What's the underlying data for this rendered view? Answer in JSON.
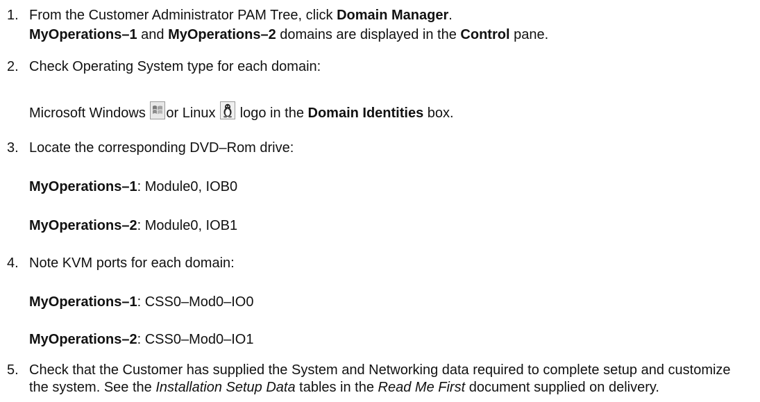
{
  "steps": [
    {
      "number": "1.",
      "line1": {
        "pre": "From the Customer Administrator PAM Tree, click ",
        "bold": "Domain Manager",
        "post": "."
      },
      "line2": {
        "bold1": "MyOperations–1",
        "mid1": " and ",
        "bold2": "MyOperations–2",
        "mid2": " domains are displayed in the ",
        "bold3": "Control",
        "post": " pane."
      }
    },
    {
      "number": "2.",
      "line1": "Check Operating System type for each domain:",
      "line2": {
        "pre": "Microsoft Windows ",
        "windows_icon": "windows-logo-icon",
        "mid": "or Linux ",
        "linux_icon": "linux-tux-logo-icon",
        "mid2": " logo in the ",
        "bold": "Domain Identities",
        "post": " box."
      }
    },
    {
      "number": "3.",
      "line1": "Locate the corresponding DVD–Rom drive:",
      "entries": [
        {
          "name": "MyOperations–1",
          "value": ": Module0, IOB0"
        },
        {
          "name": "MyOperations–2",
          "value": ": Module0, IOB1"
        }
      ]
    },
    {
      "number": "4.",
      "line1": "Note KVM ports for each domain:",
      "entries": [
        {
          "name": "MyOperations–1",
          "value": ": CSS0–Mod0–IO0"
        },
        {
          "name": "MyOperations–2",
          "value": ": CSS0–Mod0–IO1"
        }
      ]
    },
    {
      "number": "5.",
      "text1": "Check that the Customer has supplied the System and Networking data required to complete setup and customize the system. See the ",
      "italic1": "Installation Setup Data",
      "text2": " tables in the ",
      "italic2": "Read Me First",
      "text3": " document supplied on delivery."
    }
  ]
}
